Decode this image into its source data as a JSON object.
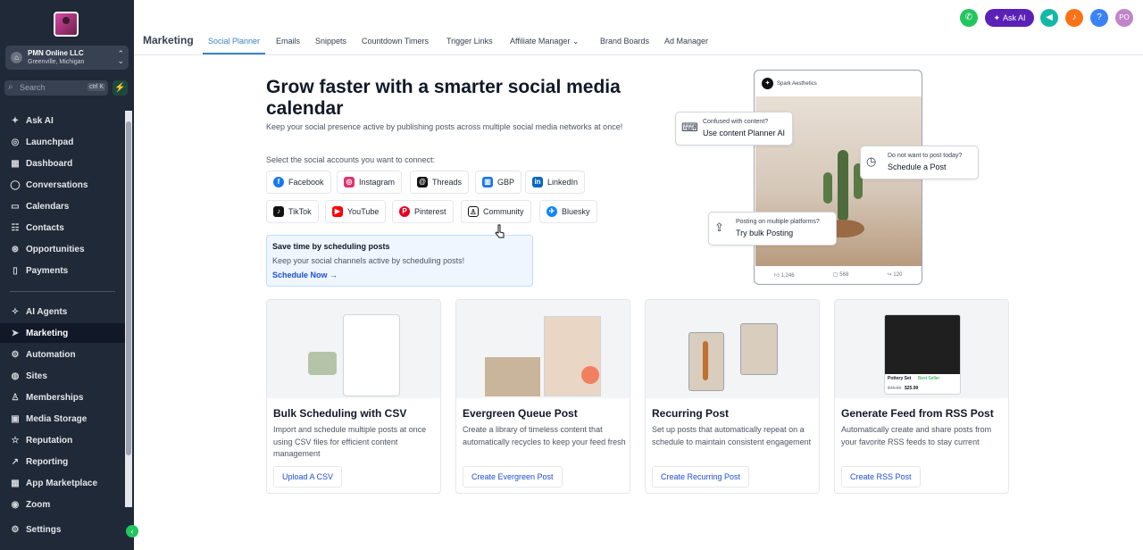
{
  "sidebar": {
    "account": {
      "name": "PMN Online LLC",
      "location": "Greenville, Michigan"
    },
    "search": {
      "label": "Search",
      "shortcut": "ctrl K"
    },
    "items": [
      {
        "label": "Ask AI",
        "icon": "sparkle-icon"
      },
      {
        "label": "Launchpad",
        "icon": "rocket-icon"
      },
      {
        "label": "Dashboard",
        "icon": "grid-icon"
      },
      {
        "label": "Conversations",
        "icon": "chat-icon"
      },
      {
        "label": "Calendars",
        "icon": "calendar-icon"
      },
      {
        "label": "Contacts",
        "icon": "contacts-icon"
      },
      {
        "label": "Opportunities",
        "icon": "target-icon"
      },
      {
        "label": "Payments",
        "icon": "payments-icon"
      }
    ],
    "items2": [
      {
        "label": "AI Agents",
        "icon": "agents-icon"
      },
      {
        "label": "Marketing",
        "icon": "send-icon"
      },
      {
        "label": "Automation",
        "icon": "automation-icon"
      },
      {
        "label": "Sites",
        "icon": "globe-icon"
      },
      {
        "label": "Memberships",
        "icon": "memberships-icon"
      },
      {
        "label": "Media Storage",
        "icon": "media-icon"
      },
      {
        "label": "Reputation",
        "icon": "star-icon"
      },
      {
        "label": "Reporting",
        "icon": "chart-icon"
      },
      {
        "label": "App Marketplace",
        "icon": "apps-icon"
      },
      {
        "label": "Zoom",
        "icon": "zoom-icon"
      },
      {
        "label": "Settings",
        "icon": "gear-icon"
      }
    ],
    "active": "Marketing"
  },
  "header": {
    "section": "Marketing",
    "tabs": [
      "Social Planner",
      "Emails",
      "Snippets",
      "Countdown Timers",
      "Trigger Links",
      "Affiliate Manager",
      "Brand Boards",
      "Ad Manager"
    ],
    "active_tab": "Social Planner",
    "ask_ai": "Ask AI",
    "avatar_initials": "PO"
  },
  "hero": {
    "title": "Grow faster with a smarter social media calendar",
    "subtitle": "Keep your social presence active by publishing posts across multiple social media networks at once!",
    "connect_label": "Select the social accounts you want to connect:",
    "accounts_row1": [
      "Facebook",
      "Instagram",
      "Threads",
      "GBP",
      "LinkedIn"
    ],
    "accounts_row2": [
      "TikTok",
      "YouTube",
      "Pinterest",
      "Community",
      "Bluesky"
    ],
    "promo": {
      "title": "Save time by scheduling posts",
      "text": "Keep your social channels active by scheduling posts!",
      "link": "Schedule Now"
    }
  },
  "mockup": {
    "brand": "Spark Aesthetics",
    "stats": [
      "1,246",
      "568",
      "120"
    ],
    "callouts": [
      {
        "small": "Confused with content?",
        "big": "Use content Planner AI"
      },
      {
        "small": "Do not want to post today?",
        "big": "Schedule a Post"
      },
      {
        "small": "Posting on multiple platforms?",
        "big": "Try bulk Posting"
      }
    ]
  },
  "cards": [
    {
      "title": "Bulk Scheduling with CSV",
      "desc": "Import and schedule multiple posts at once using CSV files for efficient content management",
      "button": "Upload A CSV"
    },
    {
      "title": "Evergreen Queue Post",
      "desc": "Create a library of timeless content that automatically recycles to keep your feed fresh",
      "button": "Create Evergreen Post"
    },
    {
      "title": "Recurring Post",
      "desc": "Set up posts that automatically repeat on a schedule to maintain consistent engagement",
      "button": "Create Recurring Post"
    },
    {
      "title": "Generate Feed from RSS Post",
      "desc": "Automatically create and share posts from your favorite RSS feeds to stay current",
      "button": "Create RSS Post"
    }
  ],
  "card_image": {
    "product_name": "Pottery Set",
    "badge": "Best Seller",
    "old_price": "$45.99",
    "price": "$25.99"
  }
}
